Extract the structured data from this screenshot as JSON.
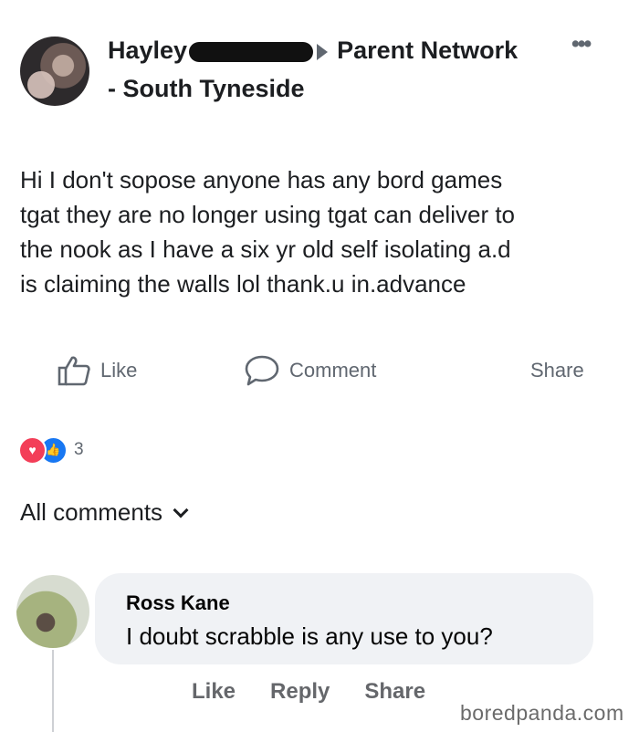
{
  "post": {
    "author_name": "Hayley",
    "group_name": "Parent Network",
    "location": "- South Tyneside",
    "more_label": "•••",
    "text_lines": [
      "Hi I don't sopose anyone has any bord games",
      "tgat they are no longer using tgat can deliver to",
      "the nook as I have a six yr old self isolating a.d",
      "is claiming the walls lol  thank.u in.advance"
    ]
  },
  "actions": {
    "like": "Like",
    "comment": "Comment",
    "share": "Share"
  },
  "reactions": {
    "count": "3",
    "types": [
      "love",
      "like"
    ]
  },
  "comments_section": {
    "filter_label": "All comments"
  },
  "comment": {
    "author": "Ross Kane",
    "text": "I doubt scrabble is any use to you?",
    "actions": [
      "Like",
      "Reply",
      "Share"
    ]
  },
  "watermark": {
    "text": "boredpanda.com"
  },
  "colors": {
    "text": "#1c1e21",
    "muted": "#606770",
    "love_reaction": "#f33e58",
    "like_reaction": "#1877f2",
    "bubble": "#f0f2f5"
  }
}
